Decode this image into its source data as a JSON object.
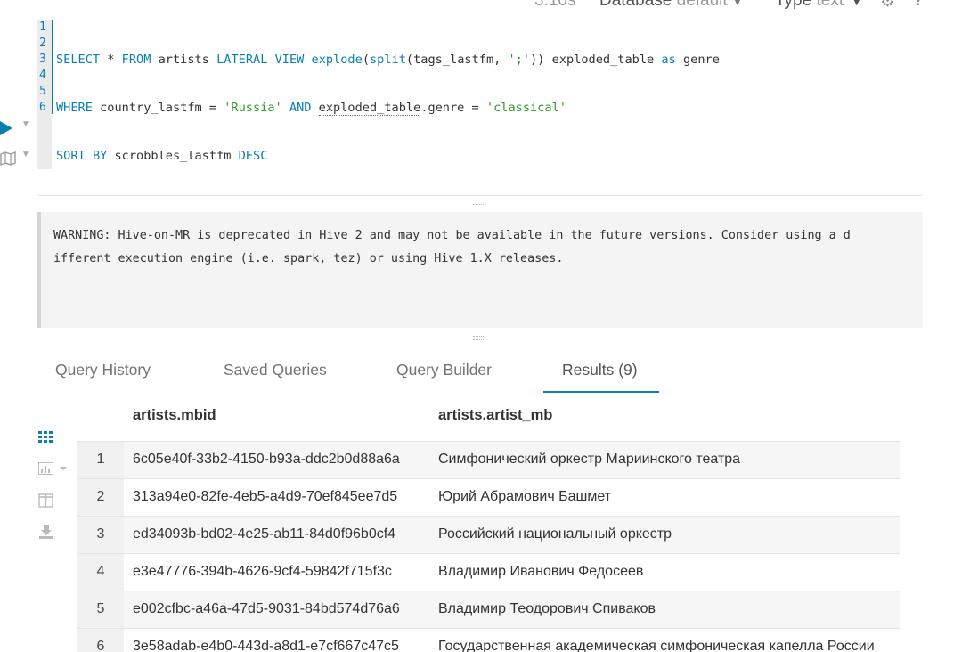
{
  "topbar": {
    "time": "3.10s",
    "database_label": "Database",
    "database_value": "default",
    "type_label": "Type",
    "type_value": "text",
    "help": "?"
  },
  "editor": {
    "line_numbers": [
      "1",
      "2",
      "3",
      "4",
      "5",
      "6"
    ],
    "query_lines": [
      "SELECT * FROM artists LATERAL VIEW explode(split(tags_lastfm, ';')) exploded_table as genre",
      "WHERE country_lastfm = 'Russia' AND exploded_table.genre = 'classical'",
      "SORT BY scrobbles_lastfm DESC"
    ]
  },
  "log": {
    "text": "WARNING: Hive-on-MR is deprecated in Hive 2 and may not be available in the future versions. Consider using a d\nifferent execution engine (i.e. spark, tez) or using Hive 1.X releases."
  },
  "tabs": [
    {
      "label": "Query History",
      "active": false
    },
    {
      "label": "Saved Queries",
      "active": false
    },
    {
      "label": "Query Builder",
      "active": false
    },
    {
      "label": "Results (9)",
      "active": true
    }
  ],
  "results": {
    "columns": [
      "artists.mbid",
      "artists.artist_mb"
    ],
    "rows": [
      {
        "num": "1",
        "mbid": "6c05e40f-33b2-4150-b93a-ddc2b0d88a6a",
        "artist": "Симфонический оркестр Мариинского театра"
      },
      {
        "num": "2",
        "mbid": "313a94e0-82fe-4eb5-a4d9-70ef845ee7d5",
        "artist": "Юрий Абрамович Башмет"
      },
      {
        "num": "3",
        "mbid": "ed34093b-bd02-4e25-ab11-84d0f96b0cf4",
        "artist": "Российский национальный оркестр"
      },
      {
        "num": "4",
        "mbid": "e3e47776-394b-4626-9cf4-59842f715f3c",
        "artist": "Владимир Иванович Федосеев"
      },
      {
        "num": "5",
        "mbid": "e002cfbc-a46a-47d5-9031-84bd574d76a6",
        "artist": "Владимир Теодорович Спиваков"
      },
      {
        "num": "6",
        "mbid": "3e58adab-e4b0-443d-a8d1-e7cf667c47c5",
        "artist": "Государственная академическая симфоническая капелла России"
      }
    ]
  },
  "colors": {
    "accent": "#0B7FAD",
    "string": "#2a9d27"
  },
  "icons": [
    "play-icon",
    "chevron-down-icon",
    "map-icon",
    "grid-icon",
    "bar-chart-icon",
    "columns-icon",
    "download-icon",
    "gear-icon"
  ]
}
